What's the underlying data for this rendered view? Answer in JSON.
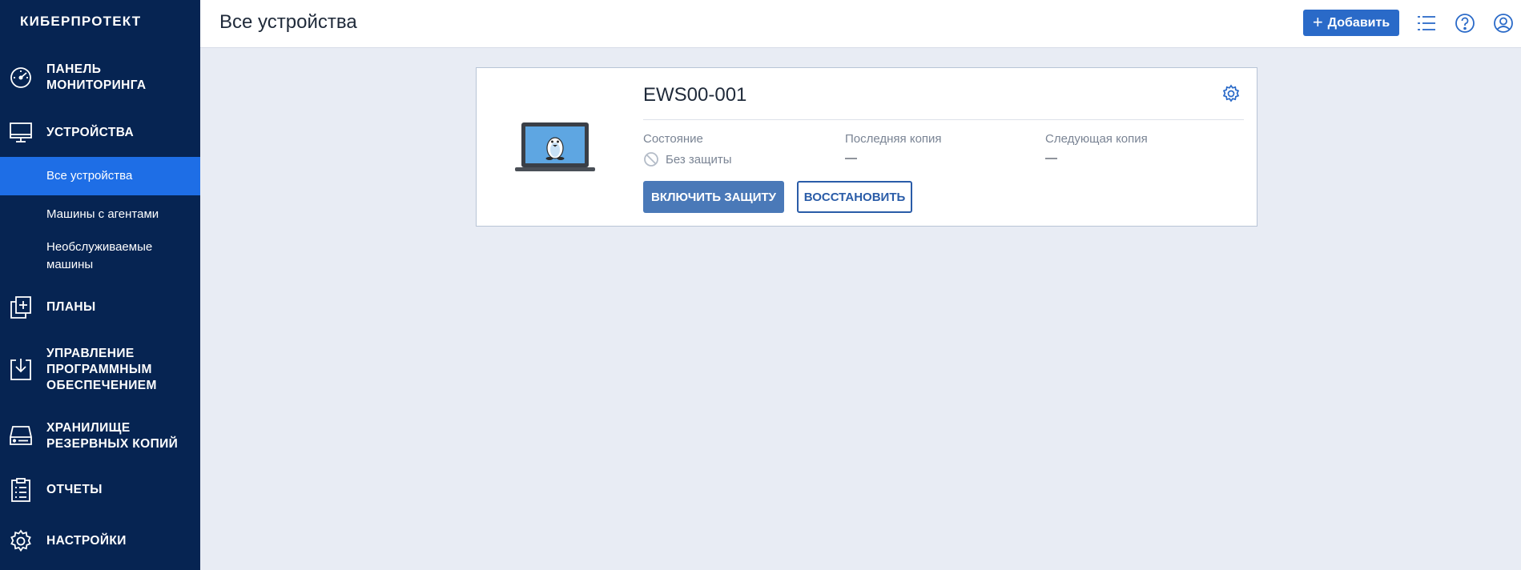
{
  "brand": {
    "logo_text": "КИБЕРПРОТЕКТ"
  },
  "sidebar": {
    "items": [
      {
        "label_line1": "ПАНЕЛЬ",
        "label_line2": "МОНИТОРИНГА",
        "icon": "dashboard-icon"
      },
      {
        "label_line1": "УСТРОЙСТВА",
        "icon": "monitor-icon"
      },
      {
        "label_line1": "ПЛАНЫ",
        "icon": "plans-icon"
      },
      {
        "label_line1": "УПРАВЛЕНИЕ",
        "label_line2": "ПРОГРАММНЫМ",
        "label_line3": "ОБЕСПЕЧЕНИЕМ",
        "icon": "download-box-icon"
      },
      {
        "label_line1": "ХРАНИЛИЩЕ",
        "label_line2": "РЕЗЕРВНЫХ КОПИЙ",
        "icon": "storage-icon"
      },
      {
        "label_line1": "ОТЧЕТЫ",
        "icon": "report-icon"
      },
      {
        "label_line1": "НАСТРОЙКИ",
        "icon": "gear-icon"
      }
    ],
    "sub_items": [
      {
        "label": "Все устройства",
        "active": true
      },
      {
        "label": "Машины с агентами"
      },
      {
        "label_line1": "Необслуживаемые",
        "label_line2": "машины"
      }
    ]
  },
  "header": {
    "title": "Все устройства",
    "add_button": {
      "icon": "plus-icon",
      "label": "Добавить"
    },
    "icons": [
      "list-icon",
      "help-icon",
      "account-icon"
    ]
  },
  "device_card": {
    "name": "EWS00-001",
    "image": "linux-laptop-icon",
    "columns": {
      "status": {
        "label": "Состояние",
        "value": "Без защиты",
        "icon": "no-protection-icon"
      },
      "last_backup": {
        "label": "Последняя копия",
        "value": "—"
      },
      "next_backup": {
        "label": "Следующая копия",
        "value": "—"
      }
    },
    "buttons": {
      "protect": "ВКЛЮЧИТЬ ЗАЩИТУ",
      "restore": "ВОССТАНОВИТЬ"
    }
  },
  "colors": {
    "sidebar_bg": "#062452",
    "sidebar_active": "#1e6ee6",
    "accent": "#2a6ac8",
    "page_bg": "#e8ecf4"
  }
}
